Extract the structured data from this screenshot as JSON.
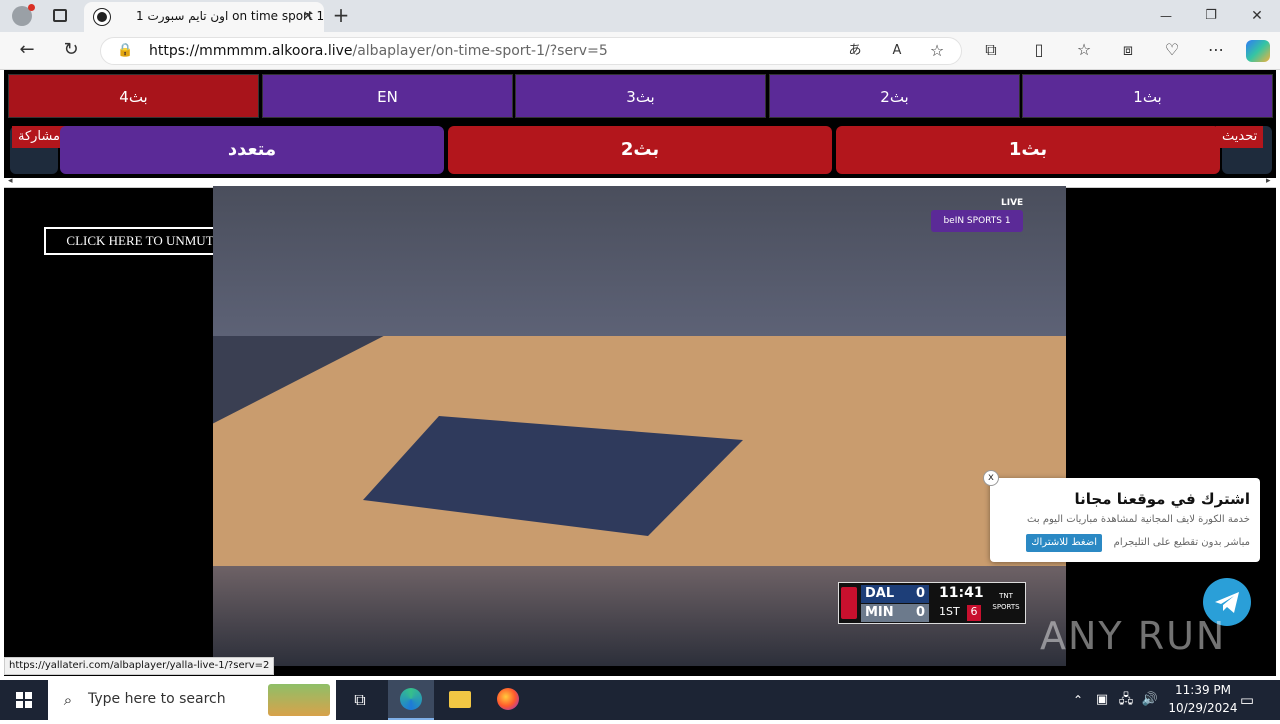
{
  "browser": {
    "tab_title": "اون تايم سبورت 1 on time sport 1",
    "url_prefix": "https://mmmmm.alkoora.live",
    "url_path": "/albaplayer/on-time-sport-1/?serv=5",
    "new_tab_glyph": "+",
    "window_controls": [
      "—",
      "❐",
      "✕"
    ]
  },
  "page": {
    "server_buttons": [
      {
        "label": "بث4",
        "color": "#a8141b"
      },
      {
        "label": "EN",
        "color": "#5b2a97"
      },
      {
        "label": "بث3",
        "color": "#5b2a97"
      },
      {
        "label": "بث2",
        "color": "#5b2a97"
      },
      {
        "label": "بث1",
        "color": "#5b2a97"
      }
    ],
    "main_buttons": [
      {
        "label": "متعدد",
        "color": "#5b2a97"
      },
      {
        "label": "بث2",
        "color": "#b3161c"
      },
      {
        "label": "بث1",
        "color": "#b3161c"
      }
    ],
    "share_label": "مشاركة",
    "refresh_label": "تحديث",
    "unmute_label": "CLICK HERE TO UNMUTE",
    "scoreboard": {
      "team1": "DAL",
      "score1": "0",
      "team2": "MIN",
      "score2": "0",
      "clock": "11:41",
      "period": "1ST",
      "shot_clock": "6",
      "network": "TNT SPORTS"
    },
    "channel_bug": {
      "live": "LIVE",
      "name": "beIN SPORTS 1"
    },
    "popup": {
      "title": "اشترك في موقعنا مجانا",
      "line1": "خدمة الكورة لايف المجانية لمشاهدة مباريات اليوم بث",
      "line2": "مباشر بدون تقطيع على التليجرام",
      "button": "اضغط للاشتراك",
      "close": "x"
    },
    "watermark": "ANY RUN",
    "status_url": "https://yallateri.com/albaplayer/yalla-live-1/?serv=2"
  },
  "taskbar": {
    "search_placeholder": "Type here to search",
    "time": "11:39 PM",
    "date": "10/29/2024"
  }
}
